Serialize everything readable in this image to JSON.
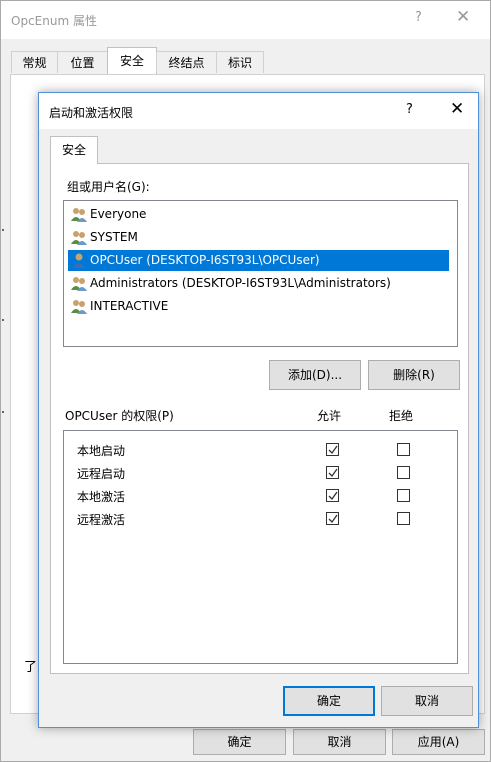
{
  "outer": {
    "title": "OpcEnum 属性",
    "help": "?",
    "close": "✕",
    "tabs": [
      "常规",
      "位置",
      "安全",
      "终结点",
      "标识"
    ],
    "active_tab": 2,
    "fragment_text": "了",
    "buttons": {
      "ok": "确定",
      "cancel": "取消",
      "apply": "应用(A)"
    }
  },
  "dialog": {
    "title": "启动和激活权限",
    "help": "?",
    "close": "✕",
    "tab": "安全",
    "group_label": "组或用户名(G):",
    "users": [
      {
        "name": "Everyone",
        "icon": "group-icon",
        "selected": false
      },
      {
        "name": "SYSTEM",
        "icon": "group-icon",
        "selected": false
      },
      {
        "name": "OPCUser (DESKTOP-I6ST93L\\OPCUser)",
        "icon": "user-icon",
        "selected": true
      },
      {
        "name": "Administrators (DESKTOP-I6ST93L\\Administrators)",
        "icon": "group-icon",
        "selected": false
      },
      {
        "name": "INTERACTIVE",
        "icon": "group-icon",
        "selected": false
      }
    ],
    "add_button": "添加(D)...",
    "remove_button": "删除(R)",
    "permissions_label": "OPCUser 的权限(P)",
    "allow_header": "允许",
    "deny_header": "拒绝",
    "permissions": [
      {
        "name": "本地启动",
        "allow": true,
        "deny": false
      },
      {
        "name": "远程启动",
        "allow": true,
        "deny": false
      },
      {
        "name": "本地激活",
        "allow": true,
        "deny": false
      },
      {
        "name": "远程激活",
        "allow": true,
        "deny": false
      }
    ],
    "ok_button": "确定",
    "cancel_button": "取消"
  },
  "colors": {
    "selection": "#0078d7",
    "dialog_border": "#4f90d8"
  }
}
